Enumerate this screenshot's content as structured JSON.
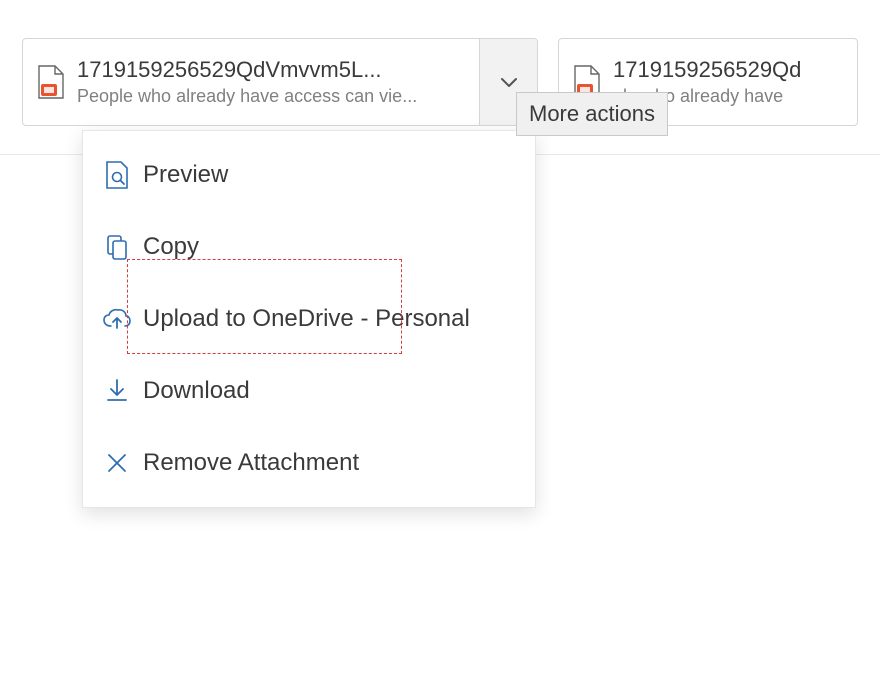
{
  "attachments": [
    {
      "filename": "1719159256529QdVmvvm5L...",
      "access": "People who already have access can vie..."
    },
    {
      "filename": "1719159256529Qd",
      "access": "ole who already have"
    }
  ],
  "tooltip": "More actions",
  "menu": {
    "items": [
      {
        "label": "Preview"
      },
      {
        "label": "Copy"
      },
      {
        "label": "Upload to OneDrive - Personal"
      },
      {
        "label": "Download"
      },
      {
        "label": "Remove Attachment"
      }
    ]
  }
}
